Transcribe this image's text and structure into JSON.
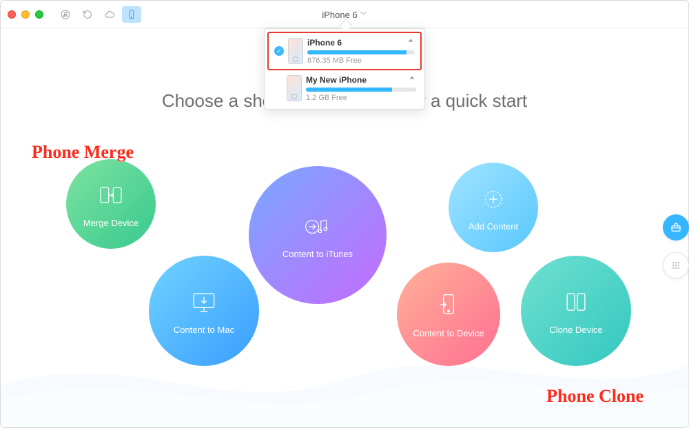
{
  "header": {
    "device_label": "iPhone 6"
  },
  "devices": [
    {
      "name": "iPhone 6",
      "free": "876.35 MB Free",
      "used_pct": 92,
      "selected": true
    },
    {
      "name": "My New iPhone",
      "free": "1.2 GB Free",
      "used_pct": 78,
      "selected": false
    }
  ],
  "heading": "Choose a shortcut from below for a quick start",
  "circles": {
    "merge": "Merge Device",
    "to_mac": "Content to Mac",
    "to_itunes": "Content to iTunes",
    "to_device": "Content to Device",
    "add": "Add Content",
    "clone": "Clone Device"
  },
  "annotations": {
    "merge": "Phone Merge",
    "clone": "Phone Clone"
  }
}
